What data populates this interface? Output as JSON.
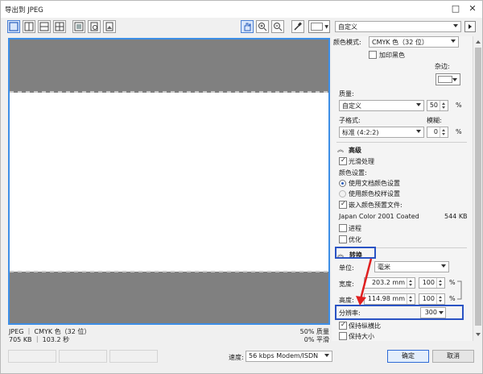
{
  "window": {
    "title": "导出到 JPEG"
  },
  "toolbar": {
    "preset": "自定义"
  },
  "panel": {
    "color_mode_label": "颜色模式:",
    "color_mode_value": "CMYK 色（32 位）",
    "add_black_label": "加印黑色",
    "matte_label": "杂边:",
    "quality_label": "质量:",
    "quality_preset": "自定义",
    "quality_value": "50",
    "quality_unit": "%",
    "subformat_label": "子格式:",
    "blur_label": "模糊:",
    "subformat_value": "标准 (4:2:2)",
    "blur_value": "0",
    "blur_unit": "%",
    "advanced": {
      "header": "高级",
      "smoothing_label": "光滑处理",
      "color_settings_label": "颜色设置:",
      "use_doc_color_label": "使用文档颜色设置",
      "use_proof_color_label": "使用颜色校样设置",
      "embed_profile_label": "嵌入颜色预置文件:",
      "profile_name": "Japan Color 2001 Coated",
      "profile_size": "544 KB",
      "progressive_label": "进程",
      "optimize_label": "优化"
    },
    "transform": {
      "header": "转换",
      "unit_label": "单位:",
      "unit_value": "毫米",
      "width_label": "宽度:",
      "width_mm": "203.2 mm",
      "width_pct": "100",
      "height_label": "高度:",
      "height_mm": "114.98 mm",
      "height_pct": "100",
      "pct_unit": "%",
      "resolution_label": "分辨率:",
      "resolution_value": "300",
      "keep_ratio_label": "保持纵横比",
      "keep_size_label": "保持大小"
    }
  },
  "preview_info": {
    "left_line1": "JPEG ｜ CMYK 色（32 位）",
    "left_line2": "705 KB ｜ 103.2 秒",
    "right_line1": "50% 质量",
    "right_line2": "0% 平滑"
  },
  "bottom": {
    "speed_label": "速度:",
    "speed_value": "56 kbps Modem/ISDN",
    "ok_label": "确定",
    "cancel_label": "取消"
  }
}
